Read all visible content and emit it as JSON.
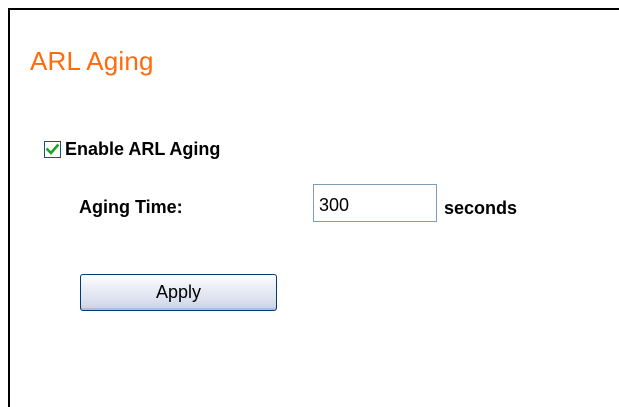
{
  "page": {
    "title": "ARL Aging",
    "title_color": "#ff6a0a"
  },
  "form": {
    "enable_checkbox": {
      "label": "Enable ARL Aging",
      "checked": true,
      "check_color": "#21a121",
      "icon": "checkmark-icon"
    },
    "aging_time": {
      "label": "Aging Time:",
      "value": "300",
      "unit_label": "seconds"
    },
    "apply_label": "Apply"
  }
}
